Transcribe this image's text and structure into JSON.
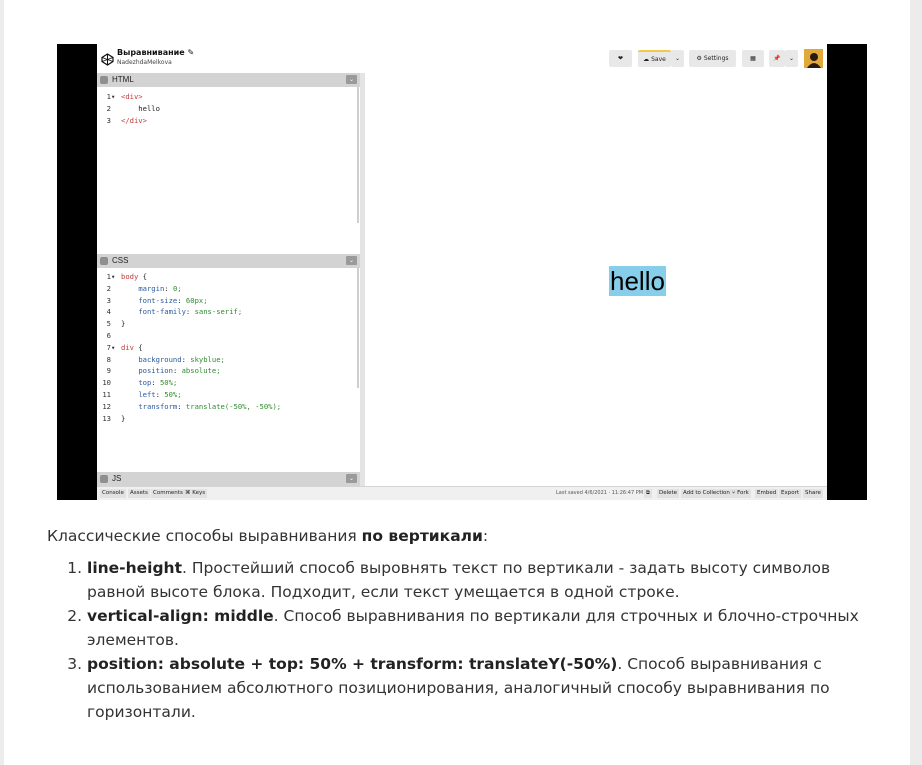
{
  "codepen": {
    "title": "Выравнивание",
    "author": "NadezhdaMelkova",
    "toolbar": {
      "save_label": "Save",
      "settings_label": "Settings"
    },
    "editors": {
      "html": {
        "label": "HTML",
        "lines": [
          {
            "n": "1",
            "fold": "▾",
            "text": "<div>"
          },
          {
            "n": "2",
            "fold": "",
            "text": "    hello"
          },
          {
            "n": "3",
            "fold": "",
            "text": "</div>"
          }
        ]
      },
      "css": {
        "label": "CSS",
        "lines": [
          {
            "n": "1",
            "fold": "▾",
            "text": "body {"
          },
          {
            "n": "2",
            "fold": "",
            "text": "    margin: 0;"
          },
          {
            "n": "3",
            "fold": "",
            "text": "    font-size: 60px;"
          },
          {
            "n": "4",
            "fold": "",
            "text": "    font-family: sans-serif;"
          },
          {
            "n": "5",
            "fold": "",
            "text": "}"
          },
          {
            "n": "6",
            "fold": "",
            "text": ""
          },
          {
            "n": "7",
            "fold": "▾",
            "text": "div {"
          },
          {
            "n": "8",
            "fold": "",
            "text": "    background: skyblue;"
          },
          {
            "n": "9",
            "fold": "",
            "text": "    position: absolute;"
          },
          {
            "n": "10",
            "fold": "",
            "text": "    top: 50%;"
          },
          {
            "n": "11",
            "fold": "",
            "text": "    left: 50%;"
          },
          {
            "n": "12",
            "fold": "",
            "text": "    transform: translate(-50%, -50%);"
          },
          {
            "n": "13",
            "fold": "",
            "text": "}"
          }
        ]
      },
      "js": {
        "label": "JS"
      }
    },
    "preview_text": "hello",
    "bottom_bar": {
      "left": [
        "Console",
        "Assets",
        "Comments",
        "⌘ Keys"
      ],
      "saved": "Last saved 4/6/2021 · 11:26:47 PM",
      "right": [
        "Delete",
        "Add to Collection",
        "Fork",
        "Embed",
        "Export",
        "Share"
      ]
    }
  },
  "article": {
    "intro_plain": "Классические способы выравнивания ",
    "intro_bold": "по вертикали",
    "intro_end": ":",
    "items": [
      {
        "bold": "line-height",
        "text": ". Простейший способ выровнять текст по вертикали - задать высоту символов равной высоте блока. Подходит, если текст умещается в одной строке."
      },
      {
        "bold": "vertical-align: middle",
        "text": ". Способ выравнивания по вертикали для строчных и блочно-строчных элементов."
      },
      {
        "bold": "position: absolute + top: 50% + transform: translateY(-50%)",
        "text": ". Способ выравнивания с использованием абсолютного позиционирования, аналогичный способу выравнивания по горизонтали."
      }
    ]
  },
  "colors": {
    "preview_bg": "#87ceeb",
    "panel_header": "#d3d3d3"
  }
}
